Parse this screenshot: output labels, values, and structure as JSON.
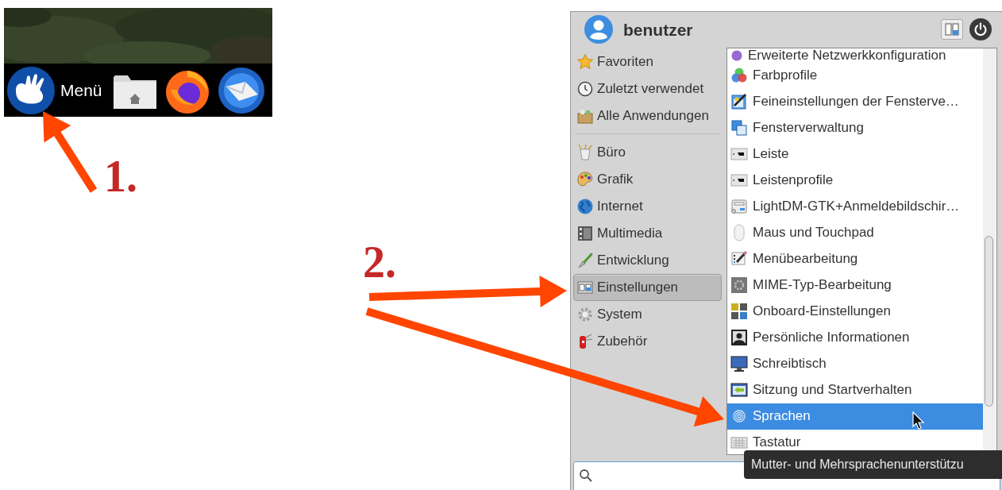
{
  "taskbar": {
    "menu_label": "Menü"
  },
  "annotations": [
    {
      "label": "1."
    },
    {
      "label": "2."
    }
  ],
  "menu": {
    "user": "benutzer",
    "places": [
      {
        "label": "Favoriten",
        "selected": false
      },
      {
        "label": "Zuletzt verwendet",
        "selected": false
      },
      {
        "label": "Alle Anwendungen",
        "selected": false
      }
    ],
    "categories": [
      {
        "label": "Büro",
        "selected": false
      },
      {
        "label": "Grafik",
        "selected": false
      },
      {
        "label": "Internet",
        "selected": false
      },
      {
        "label": "Multimedia",
        "selected": false
      },
      {
        "label": "Entwicklung",
        "selected": false
      },
      {
        "label": "Einstellungen",
        "selected": true
      },
      {
        "label": "System",
        "selected": false
      },
      {
        "label": "Zubehör",
        "selected": false
      }
    ],
    "apps": [
      {
        "label": "Erweiterte Netzwerkkonfiguration",
        "selected": false
      },
      {
        "label": "Farbprofile",
        "selected": false
      },
      {
        "label": "Feineinstellungen der Fensterve…",
        "selected": false
      },
      {
        "label": "Fensterverwaltung",
        "selected": false
      },
      {
        "label": "Leiste",
        "selected": false
      },
      {
        "label": "Leistenprofile",
        "selected": false
      },
      {
        "label": "LightDM-GTK+Anmeldebildschir…",
        "selected": false
      },
      {
        "label": "Maus und Touchpad",
        "selected": false
      },
      {
        "label": "Menübearbeitung",
        "selected": false
      },
      {
        "label": "MIME-Typ-Bearbeitung",
        "selected": false
      },
      {
        "label": "Onboard-Einstellungen",
        "selected": false
      },
      {
        "label": "Persönliche Informationen",
        "selected": false
      },
      {
        "label": "Schreibtisch",
        "selected": false
      },
      {
        "label": "Sitzung und Startverhalten",
        "selected": false
      },
      {
        "label": "Sprachen",
        "selected": true
      },
      {
        "label": "Tastatur",
        "selected": false
      }
    ],
    "tooltip": "Mutter- und Mehrsprachenunterstützu"
  }
}
